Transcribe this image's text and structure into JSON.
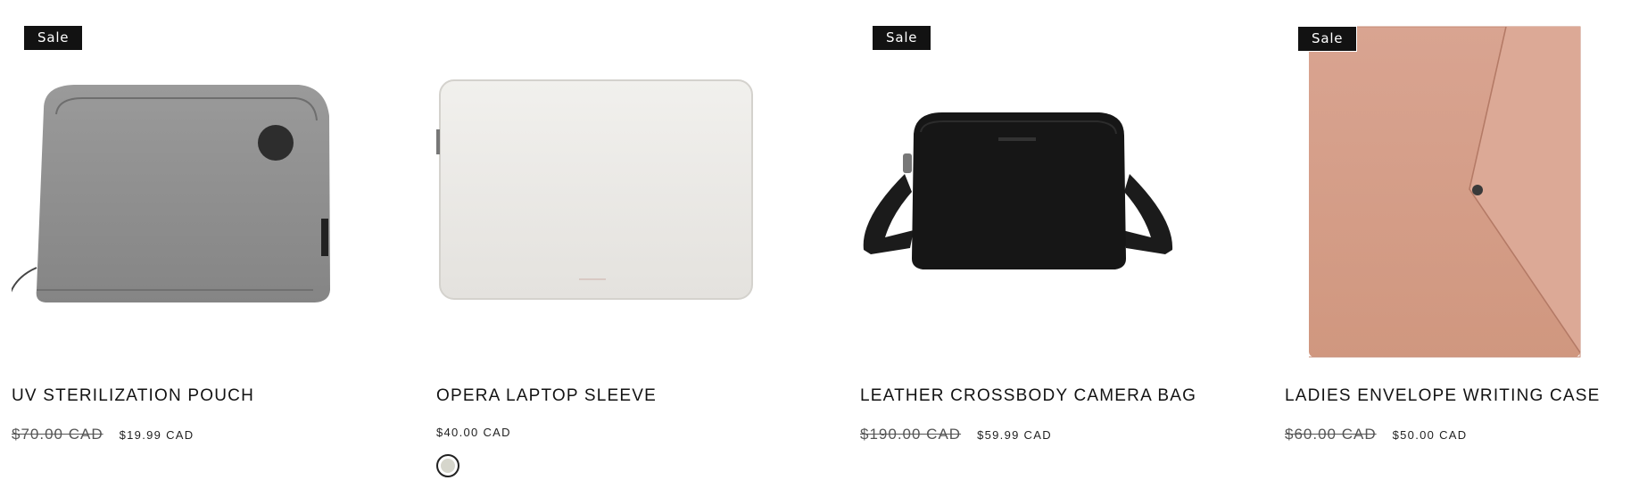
{
  "products": [
    {
      "title": "UV STERILIZATION POUCH",
      "badge": "Sale",
      "compare_price": "$70.00 CAD",
      "price": "$19.99 CAD",
      "image_icon": "gray-pouch-image",
      "image_color": "#8e8e8e"
    },
    {
      "title": "OPERA LAPTOP SLEEVE",
      "badge": "",
      "price": "$40.00 CAD",
      "swatch_color": "#d6d6cc",
      "image_icon": "white-laptop-sleeve-image",
      "image_color": "#ebe9e5"
    },
    {
      "title": "LEATHER CROSSBODY CAMERA BAG",
      "badge": "Sale",
      "compare_price": "$190.00 CAD",
      "price": "$59.99 CAD",
      "image_icon": "black-crossbody-bag-image",
      "image_color": "#151515"
    },
    {
      "title": "LADIES ENVELOPE WRITING CASE",
      "badge": "Sale",
      "compare_price": "$60.00 CAD",
      "price": "$50.00 CAD",
      "image_icon": "pink-envelope-case-image",
      "image_color": "#d49c88"
    }
  ]
}
